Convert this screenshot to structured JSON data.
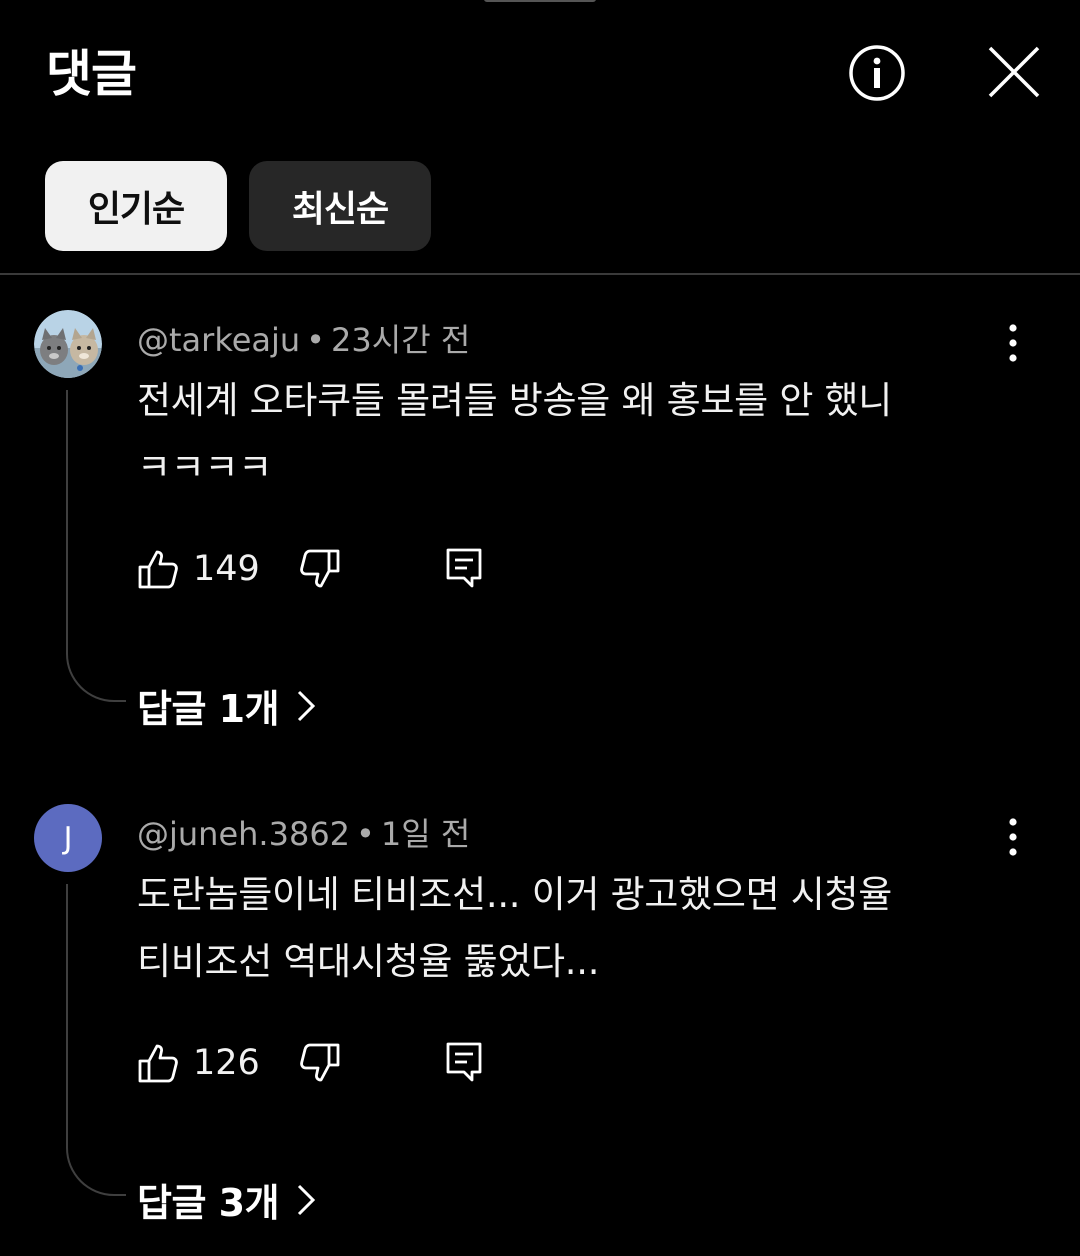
{
  "header": {
    "title": "댓글"
  },
  "sort_chips": [
    {
      "label": "인기순",
      "selected": true
    },
    {
      "label": "최신순",
      "selected": false
    }
  ],
  "comments": [
    {
      "author": "@tarkeaju",
      "time": "23시간 전",
      "text_lines": [
        "전세계 오타쿠들 몰려들 방송을 왜 홍보를 안 했니",
        "ㅋㅋㅋㅋ"
      ],
      "likes": "149",
      "replies_label": "답글 1개",
      "avatar": "cats-photo"
    },
    {
      "author": "@juneh.3862",
      "time": "1일 전",
      "text_lines": [
        "도란놈들이네 티비조선... 이거 광고했으면 시청율",
        "티비조선 역대시청율 뚫었다..."
      ],
      "likes": "126",
      "replies_label": "답글 3개",
      "avatar_letter": "J"
    }
  ],
  "colors": {
    "background": "#000000",
    "chip_selected": "#f1f1f1",
    "chip_unselected": "#272727",
    "avatar_j": "#5c6bc0"
  }
}
